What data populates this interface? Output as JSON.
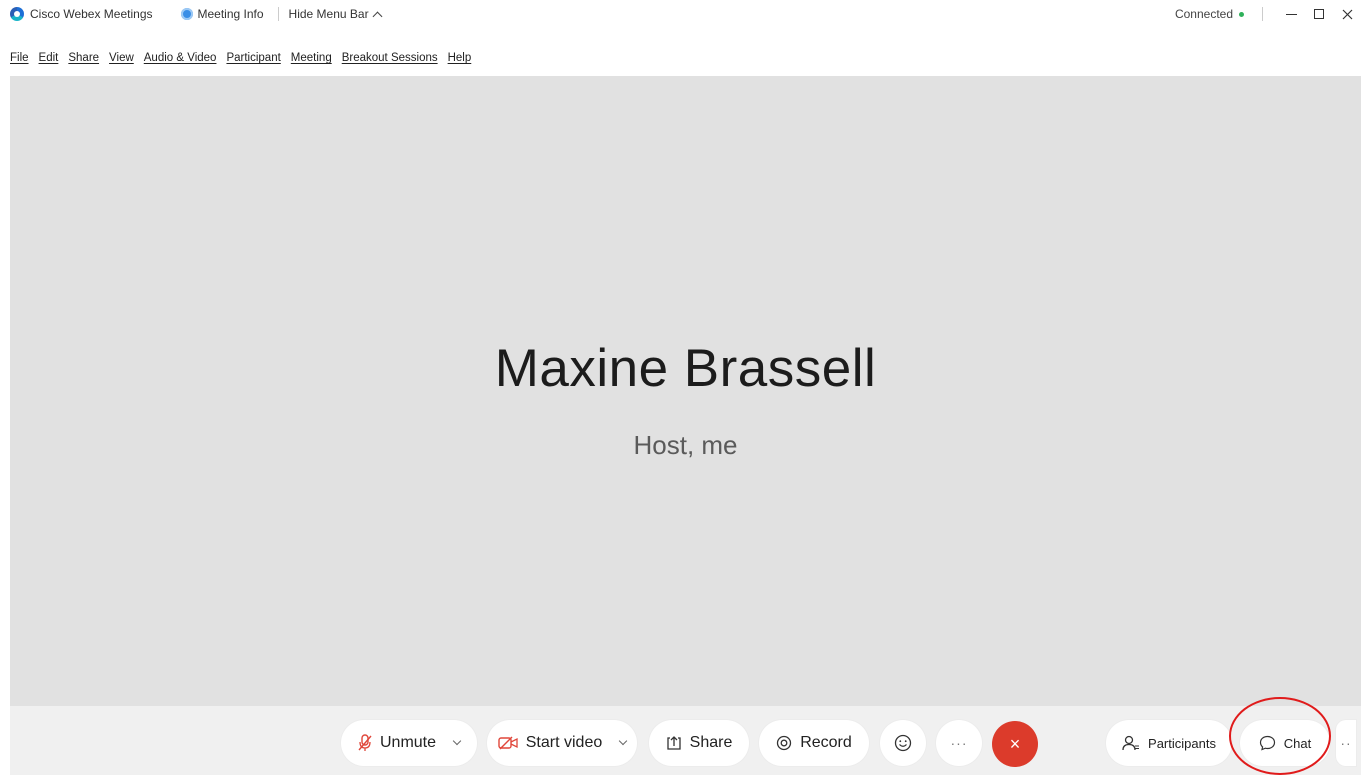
{
  "titlebar": {
    "app_title": "Cisco Webex Meetings",
    "meeting_info": "Meeting Info",
    "hide_menu": "Hide Menu Bar",
    "status": "Connected",
    "status_color": "#2fb15a"
  },
  "menu": {
    "items": [
      "File",
      "Edit",
      "Share",
      "View",
      "Audio & Video",
      "Participant",
      "Meeting",
      "Breakout Sessions",
      "Help"
    ]
  },
  "stage": {
    "name": "Maxine Brassell",
    "role": "Host, me"
  },
  "controls": {
    "unmute": "Unmute",
    "start_video": "Start video",
    "share": "Share",
    "record": "Record",
    "more": "···",
    "end_icon": "×",
    "participants": "Participants",
    "chat": "Chat",
    "overflow": "··",
    "mic_color": "#e0463a",
    "video_color": "#e0463a",
    "end_color": "#dc3b2b"
  },
  "icons": {
    "app_logo": "webex-logo-icon",
    "meeting_info": "info-icon",
    "mic": "mic-muted-icon",
    "video": "video-off-icon",
    "share": "share-icon",
    "record": "record-icon",
    "reactions": "smiley-icon",
    "participants": "participants-icon",
    "chat": "chat-bubble-icon"
  }
}
